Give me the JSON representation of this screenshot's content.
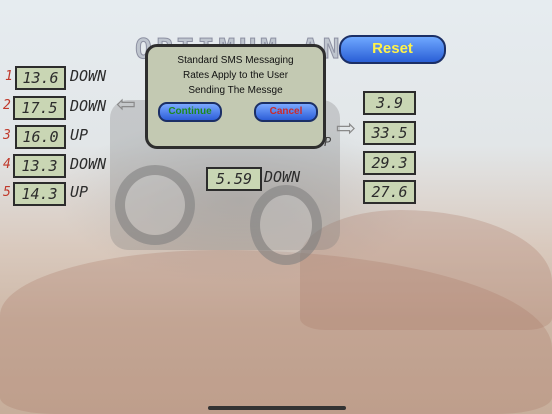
{
  "title": "OPTIMUM ANGLE",
  "reset_label": "Reset",
  "rows": [
    {
      "index": "1",
      "value": "13.6",
      "direction": "DOWN"
    },
    {
      "index": "2",
      "value": "17.5",
      "direction": "DOWN"
    },
    {
      "index": "3",
      "value": "16.0",
      "direction": "UP"
    },
    {
      "index": "4",
      "value": "13.3",
      "direction": "DOWN"
    },
    {
      "index": "5",
      "value": "14.3",
      "direction": "UP"
    }
  ],
  "center": {
    "value": "5.59",
    "direction": "DOWN"
  },
  "right_values": [
    "3.9",
    "33.5",
    "29.3",
    "27.6"
  ],
  "partial_letter": "P",
  "dialog": {
    "message_line1": "Standard SMS Messaging",
    "message_line2": "Rates Apply to the User",
    "message_line3": "Sending The Messge",
    "continue_label": "Continue",
    "cancel_label": "Cancel"
  },
  "colors": {
    "continue_text": "#1d8a1d",
    "cancel_text": "#cc2b2b",
    "reset_text": "#fff24a",
    "row_index": "#c0392b"
  },
  "icons": {
    "left_arrow": "left-arrow-icon",
    "right_arrow": "right-arrow-icon"
  }
}
